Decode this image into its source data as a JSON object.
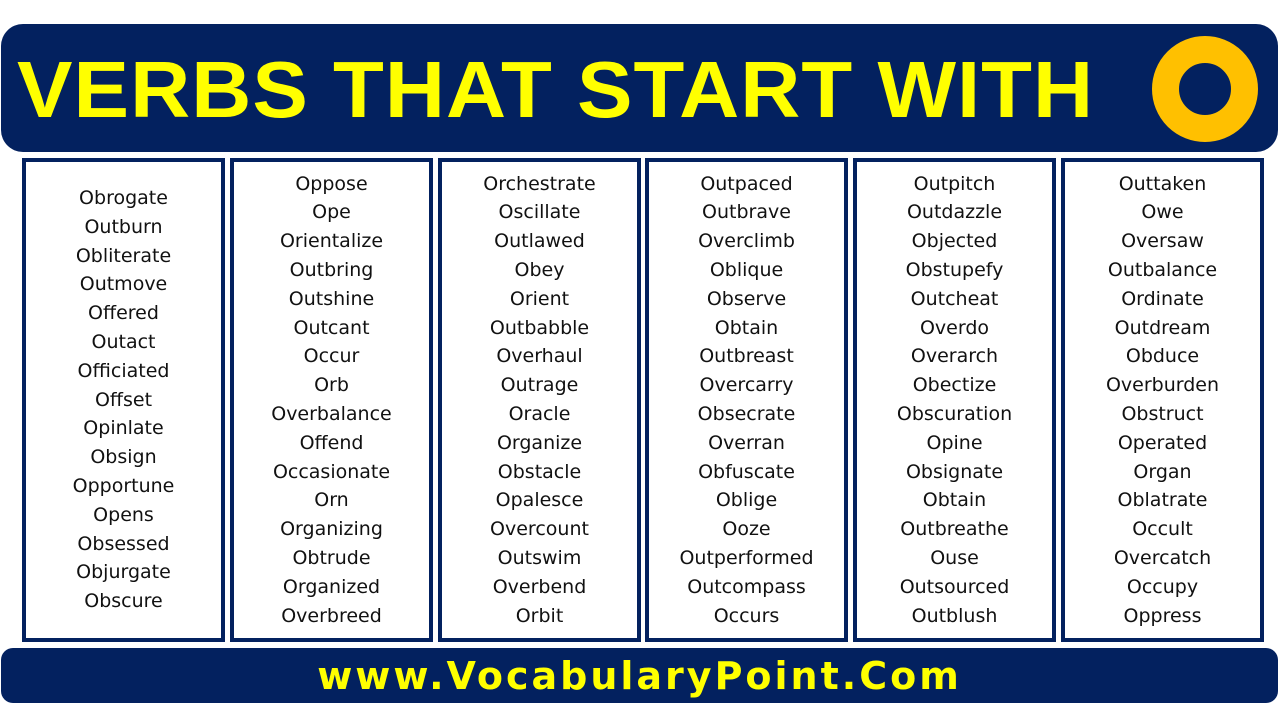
{
  "header": {
    "title": "VERBS THAT START WITH",
    "letter_icon": "letter-o-ring",
    "colors": {
      "band": "#03215f",
      "title": "#ffff00",
      "ring": "#ffc000"
    }
  },
  "columns": [
    {
      "words": [
        "Obrogate",
        "Outburn",
        "Obliterate",
        "Outmove",
        "Offered",
        "Outact",
        "Officiated",
        "Offset",
        "Opinlate",
        "Obsign",
        "Opportune",
        "Opens",
        "Obsessed",
        "Objurgate",
        "Obscure"
      ]
    },
    {
      "words": [
        "Oppose",
        "Ope",
        "Orientalize",
        "Outbring",
        "Outshine",
        "Outcant",
        "Occur",
        "Orb",
        "Overbalance",
        "Offend",
        "Occasionate",
        "Orn",
        "Organizing",
        "Obtrude",
        "Organized",
        "Overbreed"
      ]
    },
    {
      "words": [
        "Orchestrate",
        "Oscillate",
        "Outlawed",
        "Obey",
        "Orient",
        "Outbabble",
        "Overhaul",
        "Outrage",
        "Oracle",
        "Organize",
        "Obstacle",
        "Opalesce",
        "Overcount",
        "Outswim",
        "Overbend",
        "Orbit"
      ]
    },
    {
      "words": [
        "Outpaced",
        "Outbrave",
        "Overclimb",
        "Oblique",
        "Observe",
        "Obtain",
        "Outbreast",
        "Overcarry",
        "Obsecrate",
        "Overran",
        "Obfuscate",
        "Oblige",
        "Ooze",
        "Outperformed",
        "Outcompass",
        "Occurs"
      ]
    },
    {
      "words": [
        "Outpitch",
        "Outdazzle",
        "Objected",
        "Obstupefy",
        "Outcheat",
        "Overdo",
        "Overarch",
        "Obectize",
        "Obscuration",
        "Opine",
        "Obsignate",
        "Obtain",
        "Outbreathe",
        "Ouse",
        "Outsourced",
        "Outblush"
      ]
    },
    {
      "words": [
        "Outtaken",
        "Owe",
        "Oversaw",
        "Outbalance",
        "Ordinate",
        "Outdream",
        "Obduce",
        "Overburden",
        "Obstruct",
        "Operated",
        "Organ",
        "Oblatrate",
        "Occult",
        "Overcatch",
        "Occupy",
        "Oppress"
      ]
    }
  ],
  "footer": {
    "url": "www.VocabularyPoint.Com"
  }
}
